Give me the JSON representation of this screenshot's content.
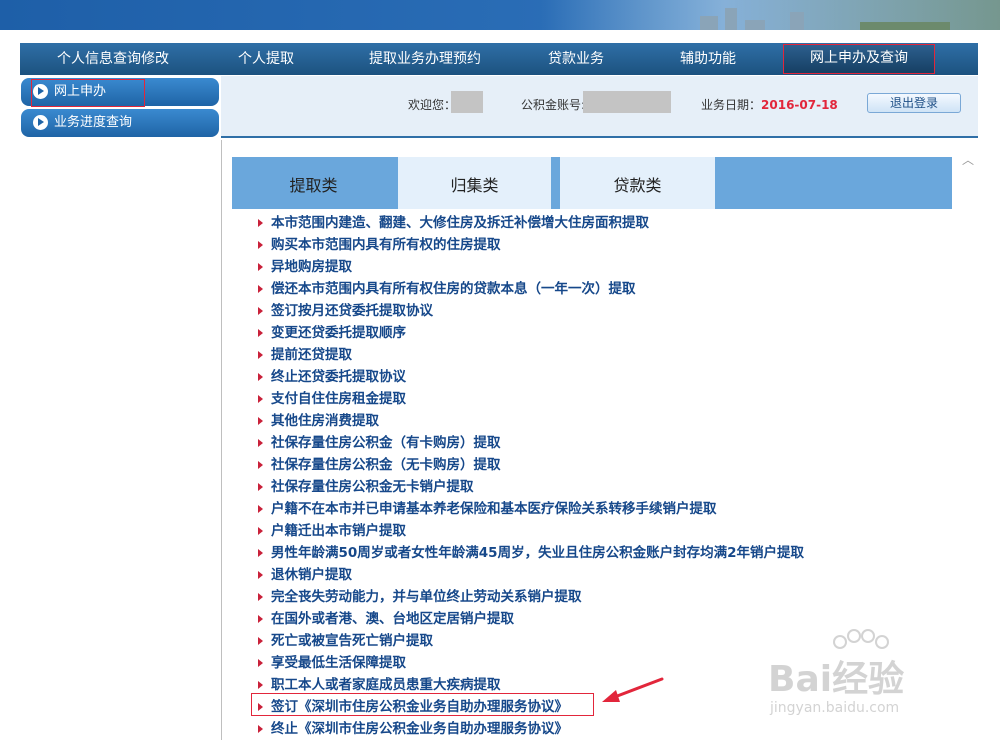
{
  "nav": {
    "items": [
      "个人信息查询修改",
      "个人提取",
      "提取业务办理预约",
      "贷款业务",
      "辅助功能",
      "网上申办及查询"
    ],
    "active_index": 5
  },
  "sidebar": {
    "items": [
      {
        "label": "网上申办",
        "icon": "arrow-circle-icon"
      },
      {
        "label": "业务进度查询",
        "icon": "arrow-circle-icon"
      }
    ]
  },
  "header": {
    "welcome_label": "欢迎您：",
    "account_label": "公积金账号:",
    "business_date_label": "业务日期：",
    "business_date": "2016-07-18",
    "logout_label": "退出登录"
  },
  "tabs": [
    {
      "label": "提取类",
      "active": true
    },
    {
      "label": "归集类",
      "active": false
    },
    {
      "label": "贷款类",
      "active": false
    }
  ],
  "list": [
    "本市范围内建造、翻建、大修住房及拆迁补偿增大住房面积提取",
    "购买本市范围内具有所有权的住房提取",
    "异地购房提取",
    "偿还本市范围内具有所有权住房的贷款本息（一年一次）提取",
    "签订按月还贷委托提取协议",
    "变更还贷委托提取顺序",
    "提前还贷提取",
    "终止还贷委托提取协议",
    "支付自住住房租金提取",
    "其他住房消费提取",
    "社保存量住房公积金（有卡购房）提取",
    "社保存量住房公积金（无卡购房）提取",
    "社保存量住房公积金无卡销户提取",
    "户籍不在本市并已申请基本养老保险和基本医疗保险关系转移手续销户提取",
    "户籍迁出本市销户提取",
    "男性年龄满50周岁或者女性年龄满45周岁，失业且住房公积金账户封存均满2年销户提取",
    "退休销户提取",
    "完全丧失劳动能力，并与单位终止劳动关系销户提取",
    "在国外或者港、澳、台地区定居销户提取",
    "死亡或被宣告死亡销户提取",
    "享受最低生活保障提取",
    "职工本人或者家庭成员患重大疾病提取",
    "签订《深圳市住房公积金业务自助办理服务协议》",
    "终止《深圳市住房公积金业务自助办理服务协议》"
  ],
  "highlight_index": 22,
  "watermark": {
    "brand": "Bai经验",
    "url": "jingyan.baidu.com"
  },
  "colors": {
    "nav_bg": "#1c527f",
    "accent_red": "#e2263b",
    "link_blue": "#16488a",
    "tab_active": "#6aa7dc",
    "tab_inactive": "#e4f0fb"
  }
}
